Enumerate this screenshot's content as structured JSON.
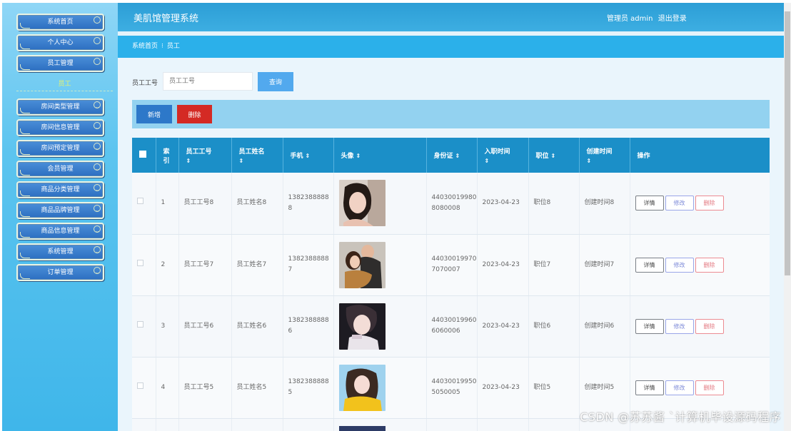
{
  "app": {
    "title": "美肌馆管理系统",
    "user_label": "管理员 admin",
    "logout_label": "退出登录"
  },
  "sidebar": {
    "items": [
      {
        "label": "系统首页"
      },
      {
        "label": "个人中心"
      },
      {
        "label": "员工管理"
      },
      {
        "label": "房间类型管理"
      },
      {
        "label": "房间信息管理"
      },
      {
        "label": "房间预定管理"
      },
      {
        "label": "会员管理"
      },
      {
        "label": "商品分类管理"
      },
      {
        "label": "商品品牌管理"
      },
      {
        "label": "商品信息管理"
      },
      {
        "label": "系统管理"
      },
      {
        "label": "订单管理"
      }
    ],
    "active_sub": "员工"
  },
  "breadcrumb": {
    "home": "系统首页",
    "separator": "⁝",
    "current": "员工"
  },
  "search": {
    "label": "员工工号",
    "placeholder": "员工工号",
    "button": "查询"
  },
  "actions": {
    "add": "新增",
    "delete": "删除"
  },
  "table": {
    "headers": {
      "index": "索引",
      "index_l1": "索",
      "index_l2": "引",
      "emp_no": "员工工号",
      "emp_name": "员工姓名",
      "phone": "手机",
      "avatar": "头像",
      "id_card": "身份证",
      "hire_date": "入职时间",
      "position": "职位",
      "created": "创建时间",
      "ops": "操作"
    },
    "sort_icon": "⇕",
    "rows": [
      {
        "index": "1",
        "emp_no": "员工工号8",
        "emp_name": "员工姓名8",
        "phone": "13823888888",
        "phone_l1": "1382388888",
        "phone_l2": "8",
        "id_card": "440300199808080008",
        "id_l1": "44030019980",
        "id_l2": "8080008",
        "hire_date": "2023-04-23",
        "position": "职位8",
        "created": "创建时间8"
      },
      {
        "index": "2",
        "emp_no": "员工工号7",
        "emp_name": "员工姓名7",
        "phone": "13823888887",
        "phone_l1": "1382388888",
        "phone_l2": "7",
        "id_card": "440300199707070007",
        "id_l1": "44030019970",
        "id_l2": "7070007",
        "hire_date": "2023-04-23",
        "position": "职位7",
        "created": "创建时间7"
      },
      {
        "index": "3",
        "emp_no": "员工工号6",
        "emp_name": "员工姓名6",
        "phone": "13823888886",
        "phone_l1": "1382388888",
        "phone_l2": "6",
        "id_card": "440300199606060006",
        "id_l1": "44030019960",
        "id_l2": "6060006",
        "hire_date": "2023-04-23",
        "position": "职位6",
        "created": "创建时间6"
      },
      {
        "index": "4",
        "emp_no": "员工工号5",
        "emp_name": "员工姓名5",
        "phone": "13823888885",
        "phone_l1": "1382388888",
        "phone_l2": "5",
        "id_card": "440300199505050005",
        "id_l1": "44030019950",
        "id_l2": "5050005",
        "hire_date": "2023-04-23",
        "position": "职位5",
        "created": "创建时间5"
      }
    ],
    "op_labels": {
      "detail": "详情",
      "edit": "修改",
      "delete": "删除"
    }
  },
  "watermark": "CSDN @苏苏酱  ˋ计算机毕设源码程序"
}
